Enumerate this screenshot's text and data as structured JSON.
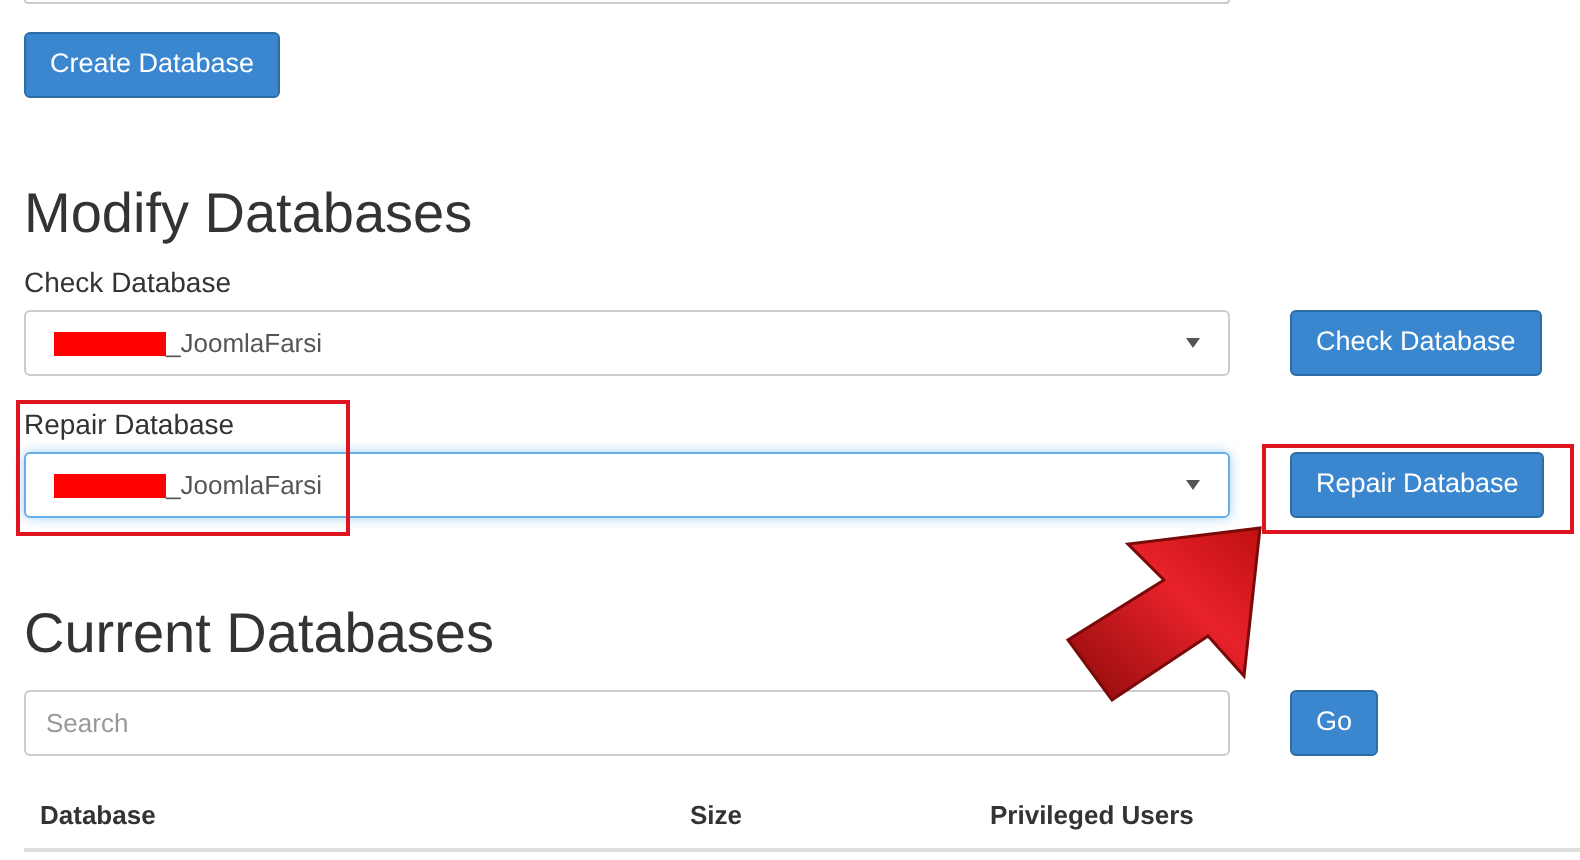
{
  "create_button": "Create Database",
  "modify": {
    "heading": "Modify Databases",
    "check": {
      "label": "Check Database",
      "value": "_JoomlaFarsi",
      "button": "Check Database",
      "focused": false
    },
    "repair": {
      "label": "Repair Database",
      "value": "_JoomlaFarsi",
      "button": "Repair Database",
      "focused": true
    }
  },
  "current": {
    "heading": "Current Databases",
    "search": {
      "placeholder": "Search"
    },
    "go_button": "Go",
    "columns": [
      "Database",
      "Size",
      "Privileged Users"
    ]
  }
}
